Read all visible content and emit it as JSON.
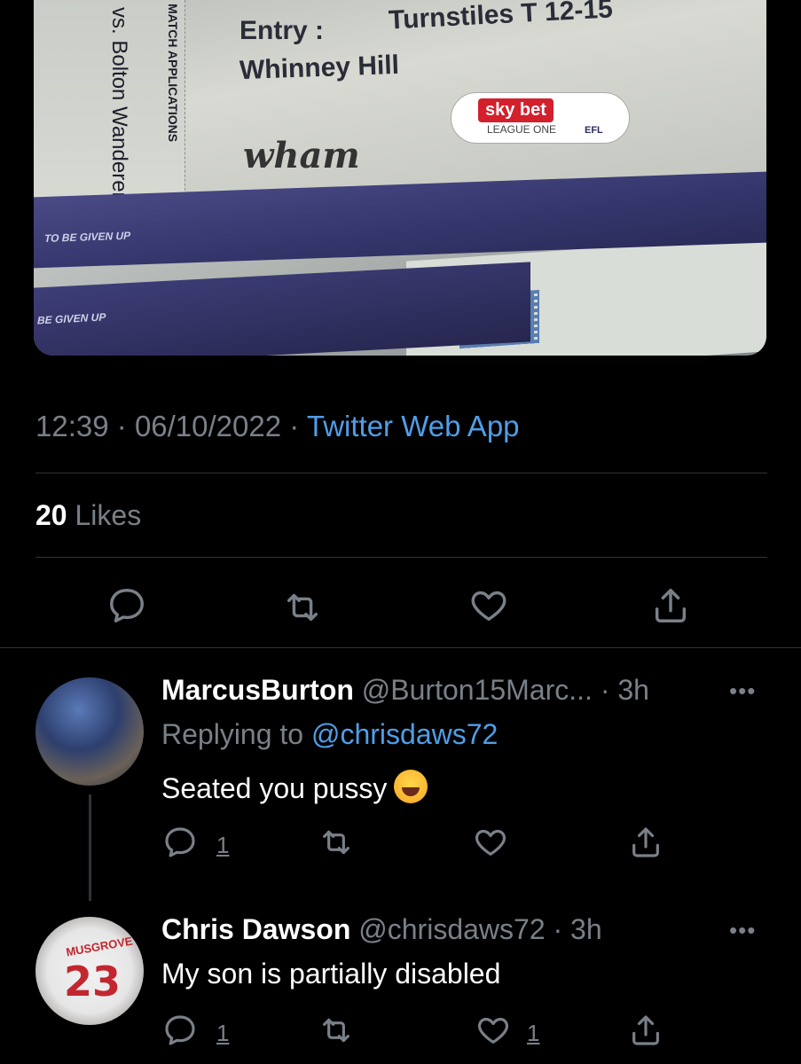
{
  "media": {
    "entry_label": "Entry :",
    "turnstiles": "Turnstiles T 12-15",
    "stand": "Whinney Hill",
    "opponent": "vs. Bolton Wanderers",
    "match_applications": "MATCH APPLICATIONS",
    "sponsor": "wham",
    "sky_bet": "sky bet",
    "league": "LEAGUE ONE",
    "efl": "EFL",
    "stub_text": "TO BE GIVEN UP",
    "stub_text_2": "BE GIVEN UP"
  },
  "tweet": {
    "time": "12:39",
    "date": "06/10/2022",
    "separator": "·",
    "source": "Twitter Web App",
    "likes_count": "20",
    "likes_label": "Likes"
  },
  "replies": [
    {
      "name": "MarcusBurton",
      "handle": "@Burton15Marc...",
      "time": "3h",
      "replying_prefix": "Replying to",
      "replying_to": "@chrisdaws72",
      "text": "Seated you pussy",
      "reply_count": "1",
      "like_count": ""
    },
    {
      "name": "Chris Dawson",
      "handle": "@chrisdaws72",
      "time": "3h",
      "text": "My son is partially disabled",
      "reply_count": "1",
      "like_count": "1",
      "shirt_name": "MUSGROVE",
      "shirt_number": "23"
    }
  ],
  "colors": {
    "background": "#000000",
    "muted": "#7a8088",
    "link": "#4f9ee8",
    "divider": "#2f3336"
  }
}
